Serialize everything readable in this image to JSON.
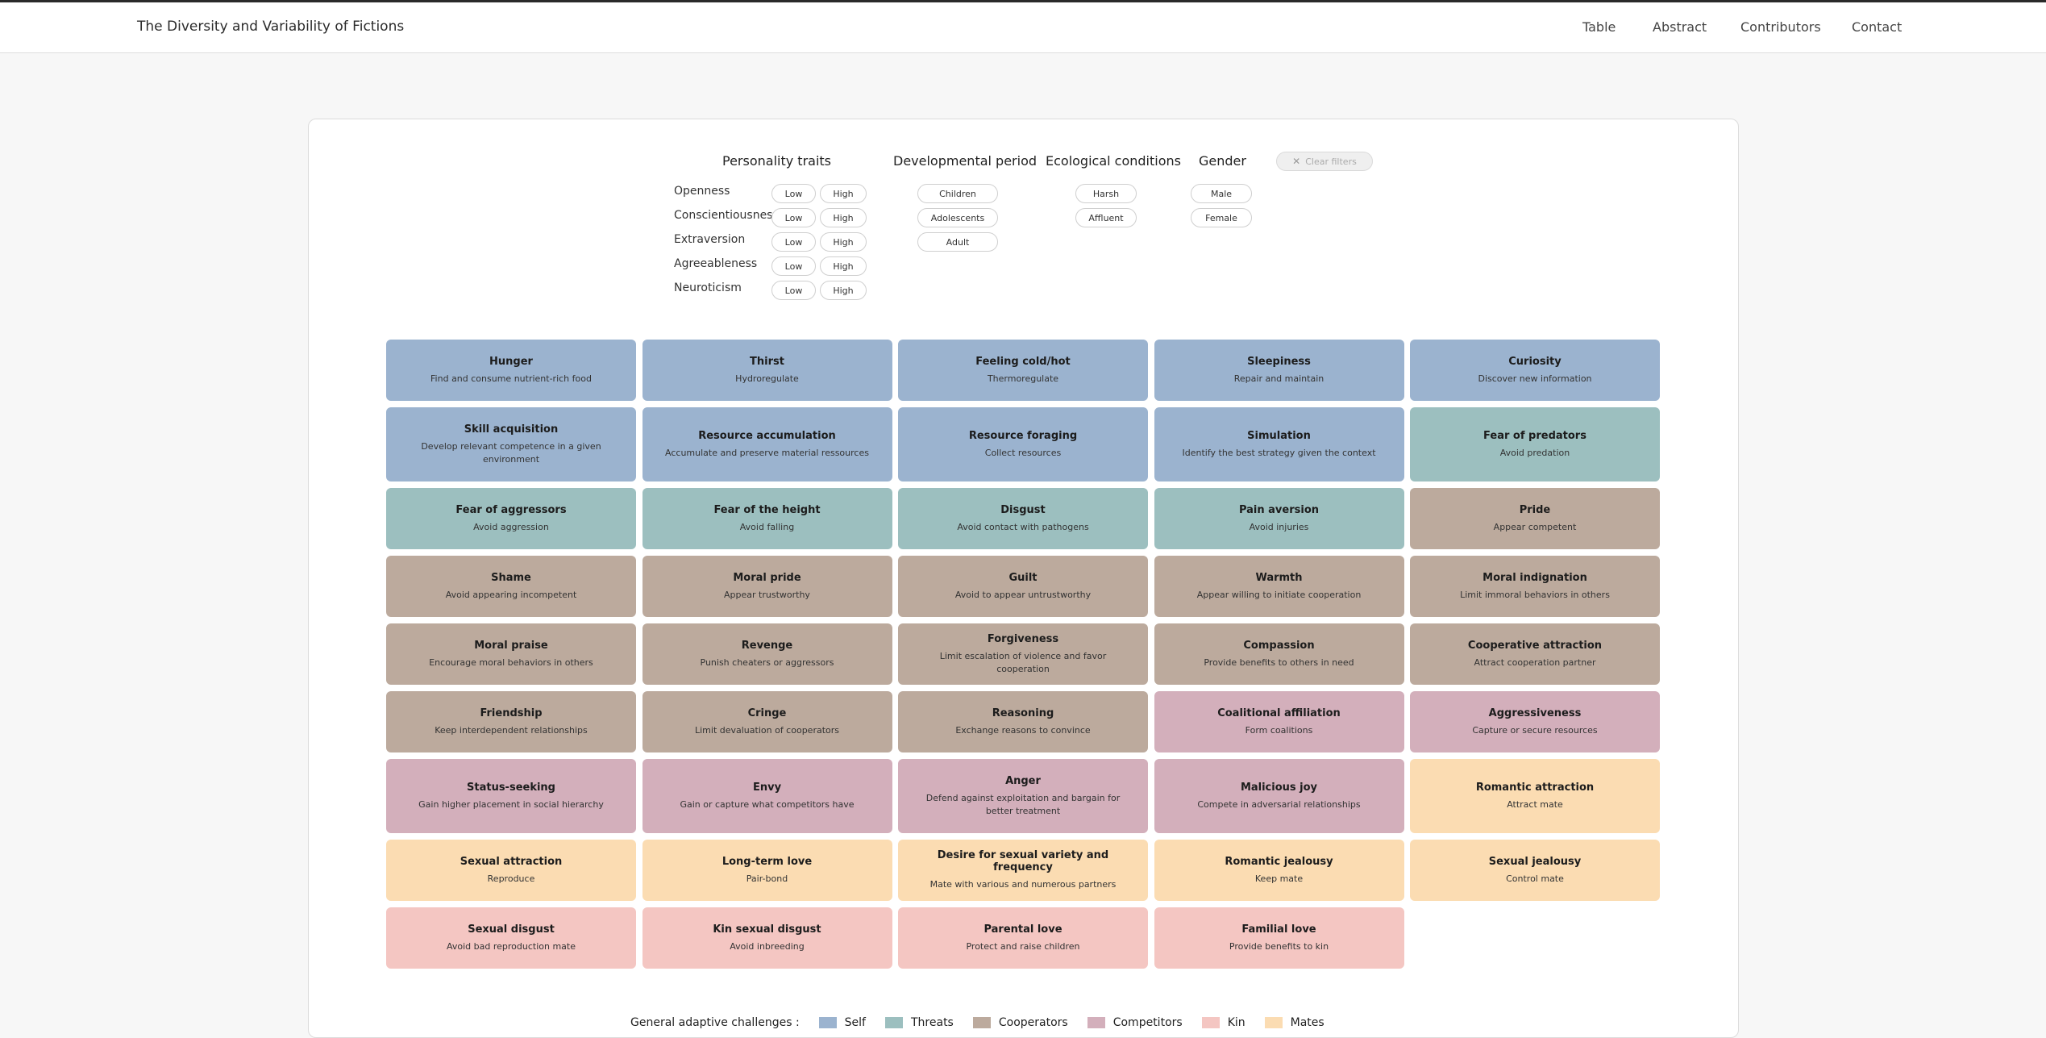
{
  "header": {
    "title": "The Diversity and Variability of Fictions",
    "nav": [
      "Table",
      "Abstract",
      "Contributors",
      "Contact"
    ]
  },
  "filters": {
    "personality": {
      "title": "Personality traits",
      "traits": [
        "Openness",
        "Conscientiousness",
        "Extraversion",
        "Agreeableness",
        "Neuroticism"
      ],
      "low": "Low",
      "high": "High"
    },
    "developmental": {
      "title": "Developmental period",
      "options": [
        "Children",
        "Adolescents",
        "Adult"
      ]
    },
    "ecological": {
      "title": "Ecological conditions",
      "options": [
        "Harsh",
        "Affluent"
      ]
    },
    "gender": {
      "title": "Gender",
      "options": [
        "Male",
        "Female"
      ]
    },
    "clear": "Clear filters"
  },
  "colors": {
    "Self": "#9bb3cf",
    "Threats": "#9cbfbf",
    "Cooperators": "#bcaa9d",
    "Competitors": "#d3afbb",
    "Kin": "#f4c6c2",
    "Mates": "#fbdcb2"
  },
  "cards": [
    {
      "title": "Hunger",
      "desc": "Find and consume nutrient-rich food",
      "cat": "Self"
    },
    {
      "title": "Thirst",
      "desc": "Hydroregulate",
      "cat": "Self"
    },
    {
      "title": "Feeling cold/hot",
      "desc": "Thermoregulate",
      "cat": "Self"
    },
    {
      "title": "Sleepiness",
      "desc": "Repair and maintain",
      "cat": "Self"
    },
    {
      "title": "Curiosity",
      "desc": "Discover new information",
      "cat": "Self"
    },
    {
      "title": "Skill acquisition",
      "desc": "Develop relevant competence in a given environment",
      "cat": "Self"
    },
    {
      "title": "Resource accumulation",
      "desc": "Accumulate and preserve material ressources",
      "cat": "Self"
    },
    {
      "title": "Resource foraging",
      "desc": "Collect resources",
      "cat": "Self"
    },
    {
      "title": "Simulation",
      "desc": "Identify the best strategy given the context",
      "cat": "Self"
    },
    {
      "title": "Fear of predators",
      "desc": "Avoid predation",
      "cat": "Threats"
    },
    {
      "title": "Fear of aggressors",
      "desc": "Avoid aggression",
      "cat": "Threats"
    },
    {
      "title": "Fear of the height",
      "desc": "Avoid falling",
      "cat": "Threats"
    },
    {
      "title": "Disgust",
      "desc": "Avoid contact with pathogens",
      "cat": "Threats"
    },
    {
      "title": "Pain aversion",
      "desc": "Avoid injuries",
      "cat": "Threats"
    },
    {
      "title": "Pride",
      "desc": "Appear competent",
      "cat": "Cooperators"
    },
    {
      "title": "Shame",
      "desc": "Avoid appearing incompetent",
      "cat": "Cooperators"
    },
    {
      "title": "Moral pride",
      "desc": "Appear trustworthy",
      "cat": "Cooperators"
    },
    {
      "title": "Guilt",
      "desc": "Avoid to appear untrustworthy",
      "cat": "Cooperators"
    },
    {
      "title": "Warmth",
      "desc": "Appear willing to initiate cooperation",
      "cat": "Cooperators"
    },
    {
      "title": "Moral indignation",
      "desc": "Limit immoral behaviors in others",
      "cat": "Cooperators"
    },
    {
      "title": "Moral praise",
      "desc": "Encourage moral behaviors in others",
      "cat": "Cooperators"
    },
    {
      "title": "Revenge",
      "desc": "Punish cheaters or aggressors",
      "cat": "Cooperators"
    },
    {
      "title": "Forgiveness",
      "desc": "Limit escalation of violence and favor cooperation",
      "cat": "Cooperators"
    },
    {
      "title": "Compassion",
      "desc": "Provide benefits to others in need",
      "cat": "Cooperators"
    },
    {
      "title": "Cooperative attraction",
      "desc": "Attract cooperation partner",
      "cat": "Cooperators"
    },
    {
      "title": "Friendship",
      "desc": "Keep interdependent relationships",
      "cat": "Cooperators"
    },
    {
      "title": "Cringe",
      "desc": "Limit devaluation of cooperators",
      "cat": "Cooperators"
    },
    {
      "title": "Reasoning",
      "desc": "Exchange reasons to convince",
      "cat": "Cooperators"
    },
    {
      "title": "Coalitional affiliation",
      "desc": "Form coalitions",
      "cat": "Competitors"
    },
    {
      "title": "Aggressiveness",
      "desc": "Capture or secure resources",
      "cat": "Competitors"
    },
    {
      "title": "Status-seeking",
      "desc": "Gain higher placement in social hierarchy",
      "cat": "Competitors"
    },
    {
      "title": "Envy",
      "desc": "Gain or capture what competitors have",
      "cat": "Competitors"
    },
    {
      "title": "Anger",
      "desc": "Defend against exploitation and bargain for better treatment",
      "cat": "Competitors"
    },
    {
      "title": "Malicious joy",
      "desc": "Compete in adversarial relationships",
      "cat": "Competitors"
    },
    {
      "title": "Romantic attraction",
      "desc": "Attract mate",
      "cat": "Mates"
    },
    {
      "title": "Sexual attraction",
      "desc": "Reproduce",
      "cat": "Mates"
    },
    {
      "title": "Long-term love",
      "desc": "Pair-bond",
      "cat": "Mates"
    },
    {
      "title": "Desire for sexual variety and frequency",
      "desc": "Mate with various and numerous partners",
      "cat": "Mates"
    },
    {
      "title": "Romantic jealousy",
      "desc": "Keep mate",
      "cat": "Mates"
    },
    {
      "title": "Sexual jealousy",
      "desc": "Control mate",
      "cat": "Mates"
    },
    {
      "title": "Sexual disgust",
      "desc": "Avoid bad reproduction mate",
      "cat": "Kin"
    },
    {
      "title": "Kin sexual disgust",
      "desc": "Avoid inbreeding",
      "cat": "Kin"
    },
    {
      "title": "Parental love",
      "desc": "Protect and raise children",
      "cat": "Kin"
    },
    {
      "title": "Familial love",
      "desc": "Provide benefits to kin",
      "cat": "Kin"
    }
  ],
  "legend": {
    "label": "General adaptive challenges :",
    "items": [
      "Self",
      "Threats",
      "Cooperators",
      "Competitors",
      "Kin",
      "Mates"
    ]
  }
}
